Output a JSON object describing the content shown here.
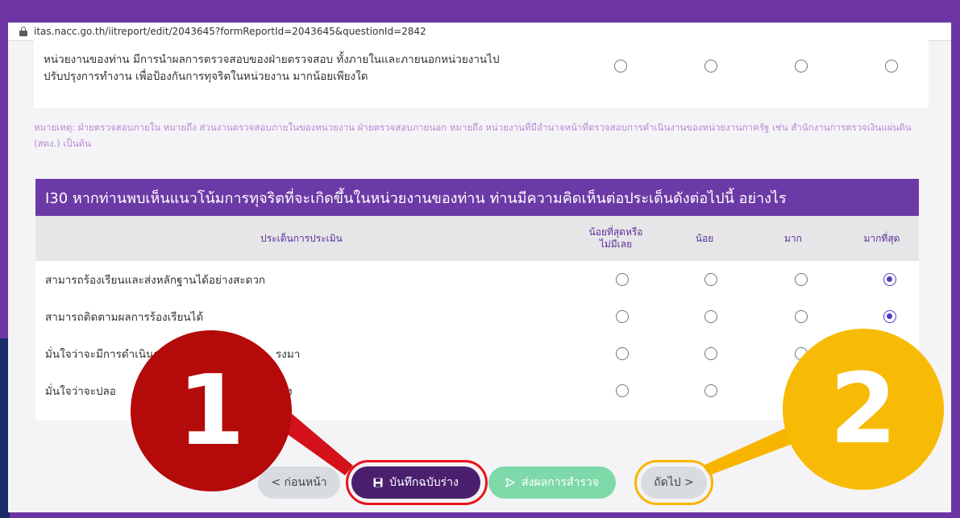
{
  "url": "itas.nacc.go.th/iitreport/edit/2043645?formReportId=2043645&questionId=2842",
  "prev_question": {
    "text_line1": "หน่วยงานของท่าน มีการนำผลการตรวจสอบของฝ่ายตรวจสอบ ทั้งภายในและภายนอกหน่วยงานไป",
    "text_line2": "ปรับปรุงการทำงาน เพื่อป้องกันการทุจริตในหน่วยงาน มากน้อยเพียงใด"
  },
  "note": "หมายเหตุ: ฝ่ายตรวจสอบภายใน หมายถึง ส่วนงานตรวจสอบภายในของหน่วยงาน ฝ่ายตรวจสอบภายนอก หมายถึง หน่วยงานที่มีอำนาจหน้าที่ตรวจสอบการดำเนินงานของหน่วยงานภาครัฐ เช่น สำนักงานการตรวจเงินแผ่นดิน (สตง.) เป็นต้น",
  "question": {
    "title": "I30 หากท่านพบเห็นแนวโน้มการทุจริตที่จะเกิดขึ้นในหน่วยงานของท่าน ท่านมีความคิดเห็นต่อประเด็นดังต่อไปนี้ อย่างไร",
    "columns": {
      "criteria": "ประเด็นการประเมิน",
      "least_line1": "น้อยที่สุดหรือ",
      "least_line2": "ไม่มีเลย",
      "little": "น้อย",
      "much": "มาก",
      "most": "มากที่สุด"
    },
    "rows": [
      {
        "label": "สามารถร้องเรียนและส่งหลักฐานได้อย่างสะดวก",
        "selected": "มากที่สุด"
      },
      {
        "label": "สามารถติดตามผลการร้องเรียนได้",
        "selected": "มากที่สุด"
      },
      {
        "label": "มั่นใจว่าจะมีการดำเนินการ",
        "label_tail": "รงมา",
        "selected": "มากที่สุด"
      },
      {
        "label": "มั่นใจว่าจะปลอ",
        "label_tail": "ง",
        "selected": ""
      }
    ]
  },
  "buttons": {
    "prev": "< ก่อนหน้า",
    "save_icon": "floppy-disk-icon",
    "save": "บันทึกฉบับร่าง",
    "send_icon": "send-arrow-icon",
    "send": "ส่งผลการสำรวจ",
    "next": "ถัดไป >"
  },
  "annotations": {
    "badge_1": "1",
    "badge_2": "2",
    "colors": {
      "badge_1": "#b40a0a",
      "ring_1": "#e8131c",
      "badge_2": "#f7bb05",
      "ring_2": "#f7b500"
    }
  }
}
